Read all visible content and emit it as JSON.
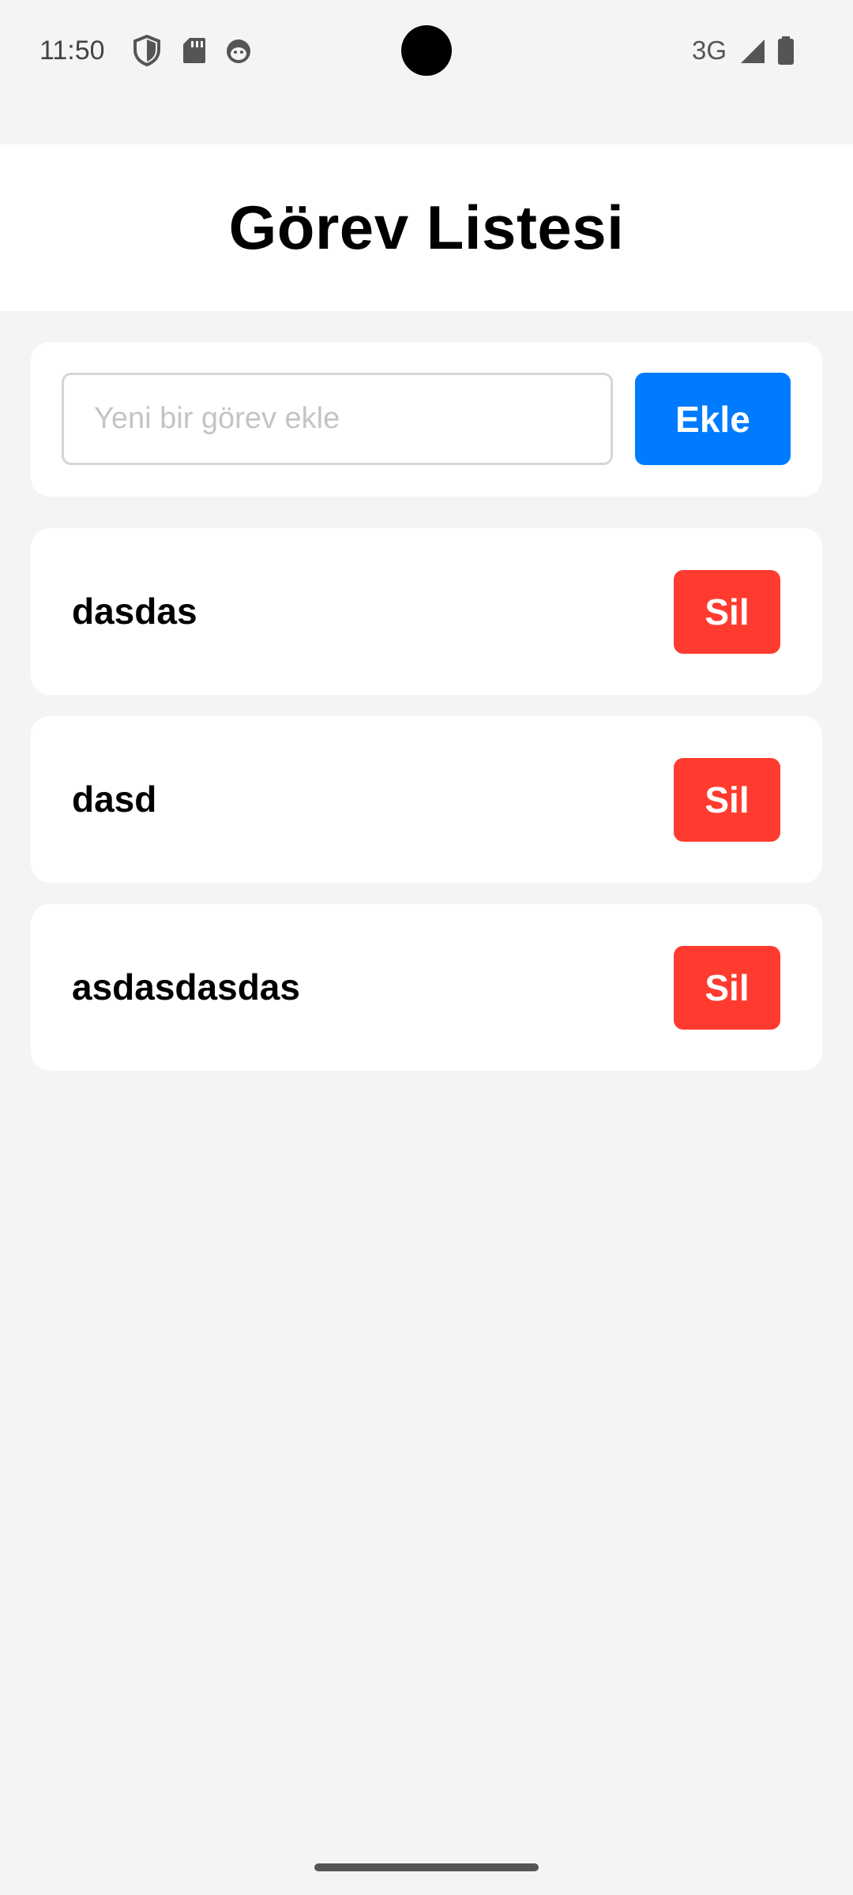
{
  "status_bar": {
    "time": "11:50",
    "network": "3G",
    "icons": [
      "shield-icon",
      "sd-card-icon",
      "face-icon",
      "signal-icon",
      "battery-icon"
    ]
  },
  "header": {
    "title": "Görev Listesi"
  },
  "add_task": {
    "placeholder": "Yeni bir görev ekle",
    "value": "",
    "button_label": "Ekle",
    "button_color": "#007bff"
  },
  "tasks": [
    {
      "text": "dasdas",
      "delete_label": "Sil"
    },
    {
      "text": "dasd",
      "delete_label": "Sil"
    },
    {
      "text": "asdasdasdas",
      "delete_label": "Sil"
    }
  ],
  "colors": {
    "background": "#f4f4f4",
    "card": "#ffffff",
    "delete": "#ff3b30"
  }
}
